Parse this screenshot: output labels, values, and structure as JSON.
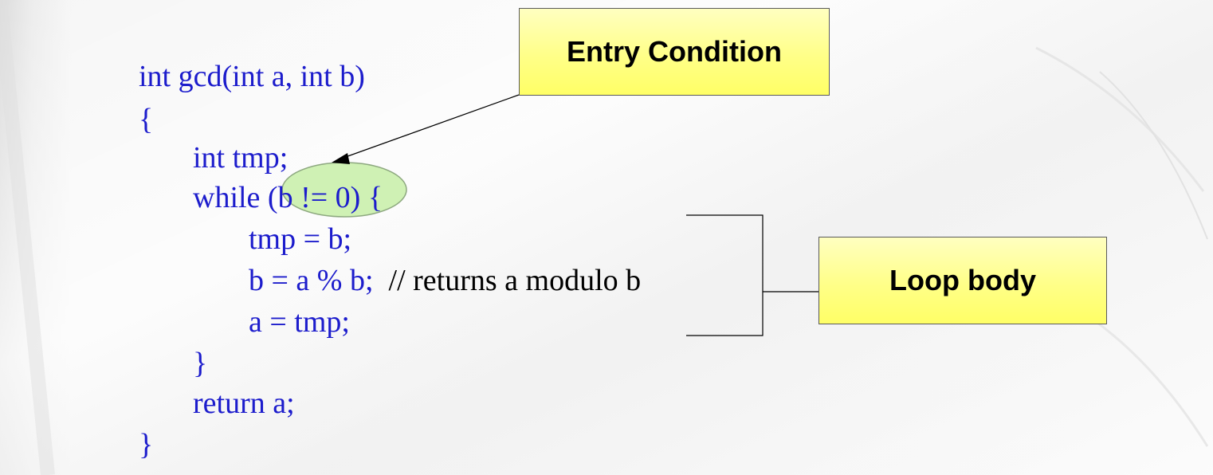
{
  "code": {
    "lines": [
      "int gcd(int a, int b)",
      "{",
      "int tmp;",
      "while (b != 0) {",
      "tmp = b;",
      "b = a % b;",
      "a = tmp;",
      "}",
      "return a;",
      "}"
    ],
    "comment": "// returns a modulo b"
  },
  "callouts": {
    "entry_condition": "Entry Condition",
    "loop_body": "Loop body"
  },
  "colors": {
    "code_text": "#1c1ccc",
    "comment_text": "#000000",
    "callout_fill": "#ffff88",
    "highlight_fill": "#c8f0a8"
  }
}
